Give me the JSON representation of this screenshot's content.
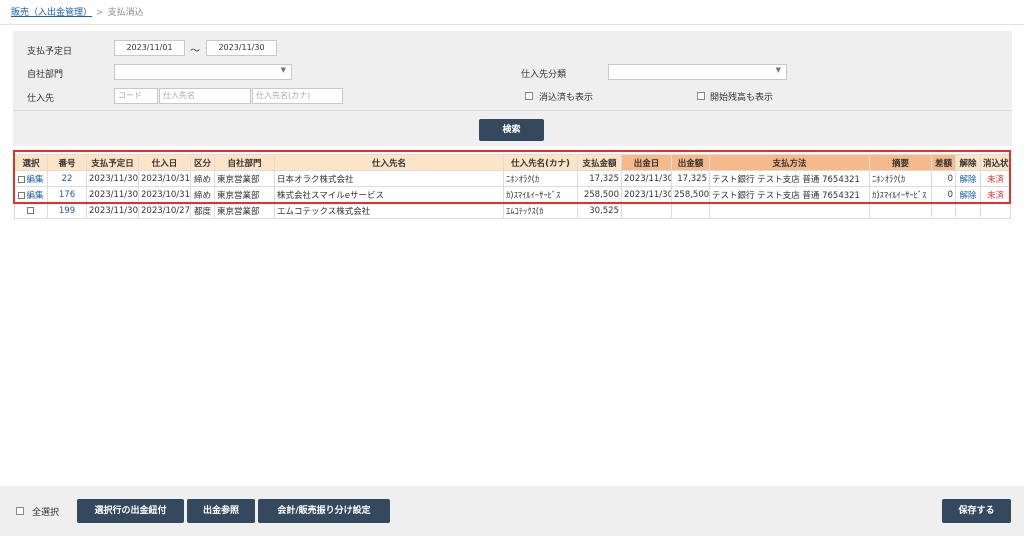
{
  "breadcrumb": {
    "parent": "販売（入出金管理）",
    "separator": ">",
    "current": "支払消込"
  },
  "search": {
    "date_label": "支払予定日",
    "date_from": "2023/11/01",
    "date_sep": "～",
    "date_to": "2023/11/30",
    "dept_label": "自社部門",
    "dept_value": "",
    "supplier_class_label": "仕入先分類",
    "supplier_class_value": "",
    "supplier_label": "仕入先",
    "code_placeholder": "コード",
    "name_placeholder": "仕入先名",
    "kana_placeholder": "仕入先名(カナ)",
    "show_cleared_label": "消込済も表示",
    "show_opening_label": "開始残高も表示",
    "search_button": "検索"
  },
  "table": {
    "headers": [
      "選択",
      "番号",
      "支払予定日",
      "仕入日",
      "区分",
      "自社部門",
      "仕入先名",
      "仕入先名(カナ)",
      "支払金額",
      "出金日",
      "出金額",
      "支払方法",
      "摘要",
      "差額",
      "解除",
      "消込状態"
    ],
    "rows": [
      {
        "select": "編集",
        "no": "22",
        "due": "2023/11/30",
        "purchase": "2023/10/31",
        "kind": "締め",
        "dept": "東京営業部",
        "name": "日本オラク株式会社",
        "kana": "ﾆﾎﾝｵﾗｸ(ｶ",
        "amount": "17,325",
        "paydate": "2023/11/30",
        "payamount": "17,325",
        "method": "テスト銀行 テスト支店 普通 7654321",
        "memo": "ﾆﾎﾝｵﾗｸ(ｶ",
        "diff": "0",
        "cancel": "解除",
        "status": "未済"
      },
      {
        "select": "編集",
        "no": "176",
        "due": "2023/11/30",
        "purchase": "2023/10/31",
        "kind": "締め",
        "dept": "東京営業部",
        "name": "株式会社スマイルeサービス",
        "kana": "ｶ)ｽﾏｲﾙｲｰｻｰﾋﾞｽ",
        "amount": "258,500",
        "paydate": "2023/11/30",
        "payamount": "258,500",
        "method": "テスト銀行 テスト支店 普通 7654321",
        "memo": "ｶ)ｽﾏｲﾙｲｰｻｰﾋﾞｽ",
        "diff": "0",
        "cancel": "解除",
        "status": "未済"
      },
      {
        "select": "",
        "no": "199",
        "due": "2023/11/30",
        "purchase": "2023/10/27",
        "kind": "都度",
        "dept": "東京営業部",
        "name": "エムコテックス株式会社",
        "kana": "ｴﾑｺﾃｯｸｽ(ｶ",
        "amount": "30,525",
        "paydate": "",
        "payamount": "",
        "method": "",
        "memo": "",
        "diff": "",
        "cancel": "",
        "status": ""
      }
    ]
  },
  "footer": {
    "select_all_label": "全選択",
    "attach_button": "選択行の出金紐付",
    "payment_ref_button": "出金参照",
    "accounting_button": "会計/販売振り分け設定",
    "save_button": "保存する"
  },
  "colors": {
    "header_bg": "#fde4c6",
    "header_dark": "#f5b98a",
    "button": "#34495e",
    "highlight": "#e0312b",
    "link": "#1a5fa8"
  }
}
